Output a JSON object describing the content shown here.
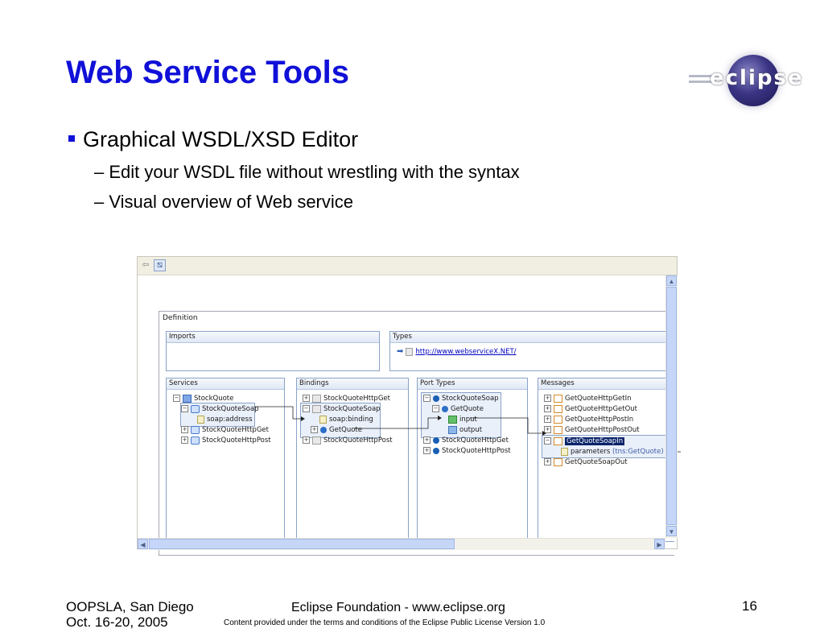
{
  "slide": {
    "title": "Web Service Tools",
    "bullet": "Graphical WSDL/XSD Editor",
    "sub_bullets": [
      "– Edit your WSDL file without wrestling with the syntax",
      "– Visual overview of Web service"
    ]
  },
  "logo": {
    "text": "eclipse",
    "icon": "eclipse-logo"
  },
  "editor": {
    "definition_label": "Definition",
    "imports_title": "Imports",
    "types_title": "Types",
    "types_url": "http://www.webserviceX.NET/",
    "services": {
      "title": "Services",
      "items": [
        "StockQuote",
        "StockQuoteSoap",
        "soap:address",
        "StockQuoteHttpGet",
        "StockQuoteHttpPost"
      ]
    },
    "bindings": {
      "title": "Bindings",
      "items": [
        "StockQuoteHttpGet",
        "StockQuoteSoap",
        "soap:binding",
        "GetQuote",
        "StockQuoteHttpPost"
      ]
    },
    "port_types": {
      "title": "Port Types",
      "items": [
        "StockQuoteSoap",
        "GetQuote",
        "input",
        "output",
        "StockQuoteHttpGet",
        "StockQuoteHttpPost"
      ]
    },
    "messages": {
      "title": "Messages",
      "items": [
        "GetQuoteHttpGetIn",
        "GetQuoteHttpGetOut",
        "GetQuoteHttpPostIn",
        "GetQuoteHttpPostOut",
        "GetQuoteSoapIn",
        "parameters",
        "(tns:GetQuote)",
        "GetQuoteSoapOut"
      ]
    },
    "colors": {
      "panel_border": "#8aa2c8",
      "selection": "#0a246a"
    }
  },
  "footer": {
    "left_line1": "OOPSLA, San Diego",
    "left_line2": "Oct. 16-20, 2005",
    "center_line1": "Eclipse Foundation - www.eclipse.org",
    "center_line2": "Content provided under the terms and conditions of the Eclipse Public License Version 1.0",
    "page_number": "16"
  },
  "colors": {
    "title": "#1010d8",
    "bullet_marker": "#1010d8"
  }
}
